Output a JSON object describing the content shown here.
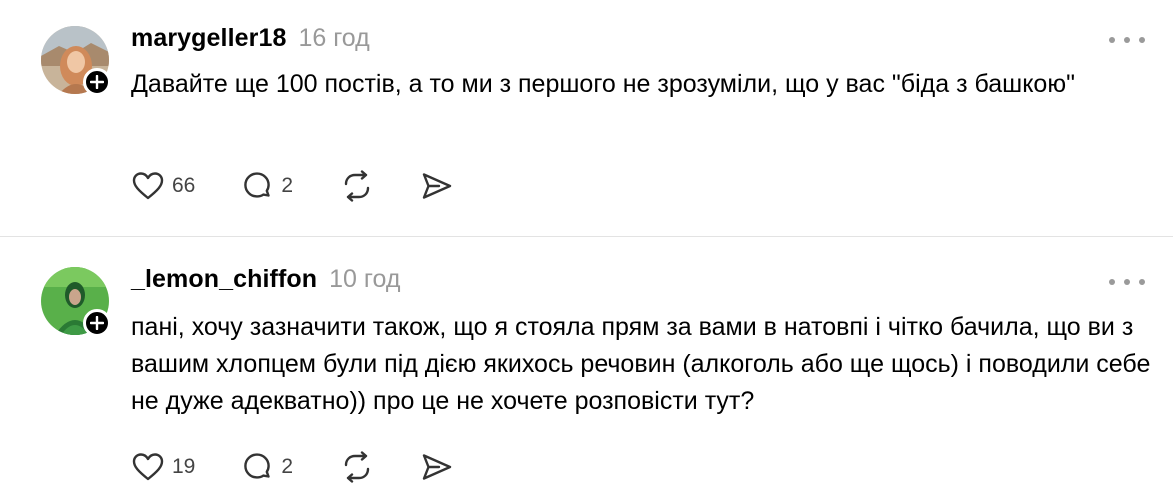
{
  "posts": [
    {
      "username": "marygeller18",
      "time": "16 год",
      "text": "Давайте ще 100 постів, а то ми з першого не зрозуміли, що у вас \"біда з башкою\"",
      "likes": "66",
      "replies": "2",
      "avatar_icon": "avatar-photo",
      "colors": {
        "avatar_bg": "#c9a27a"
      }
    },
    {
      "username": "_lemon_chiffon",
      "time": "10 год",
      "text": "пані, хочу зазначити також, що я стояла прям за вами в натовпі і чітко бачила, що ви з вашим хлопцем були під дією якихось речовин (алкоголь або ще щось) і поводили себе не дуже адекватно)) про це не хочете розповісти тут?",
      "likes": "19",
      "replies": "2",
      "avatar_icon": "avatar-photo",
      "colors": {
        "avatar_bg": "#3f9a3f"
      }
    }
  ],
  "icons": {
    "like": "heart-icon",
    "reply": "comment-icon",
    "repost": "repost-icon",
    "share": "share-icon",
    "more": "more-icon",
    "follow": "plus-icon"
  }
}
